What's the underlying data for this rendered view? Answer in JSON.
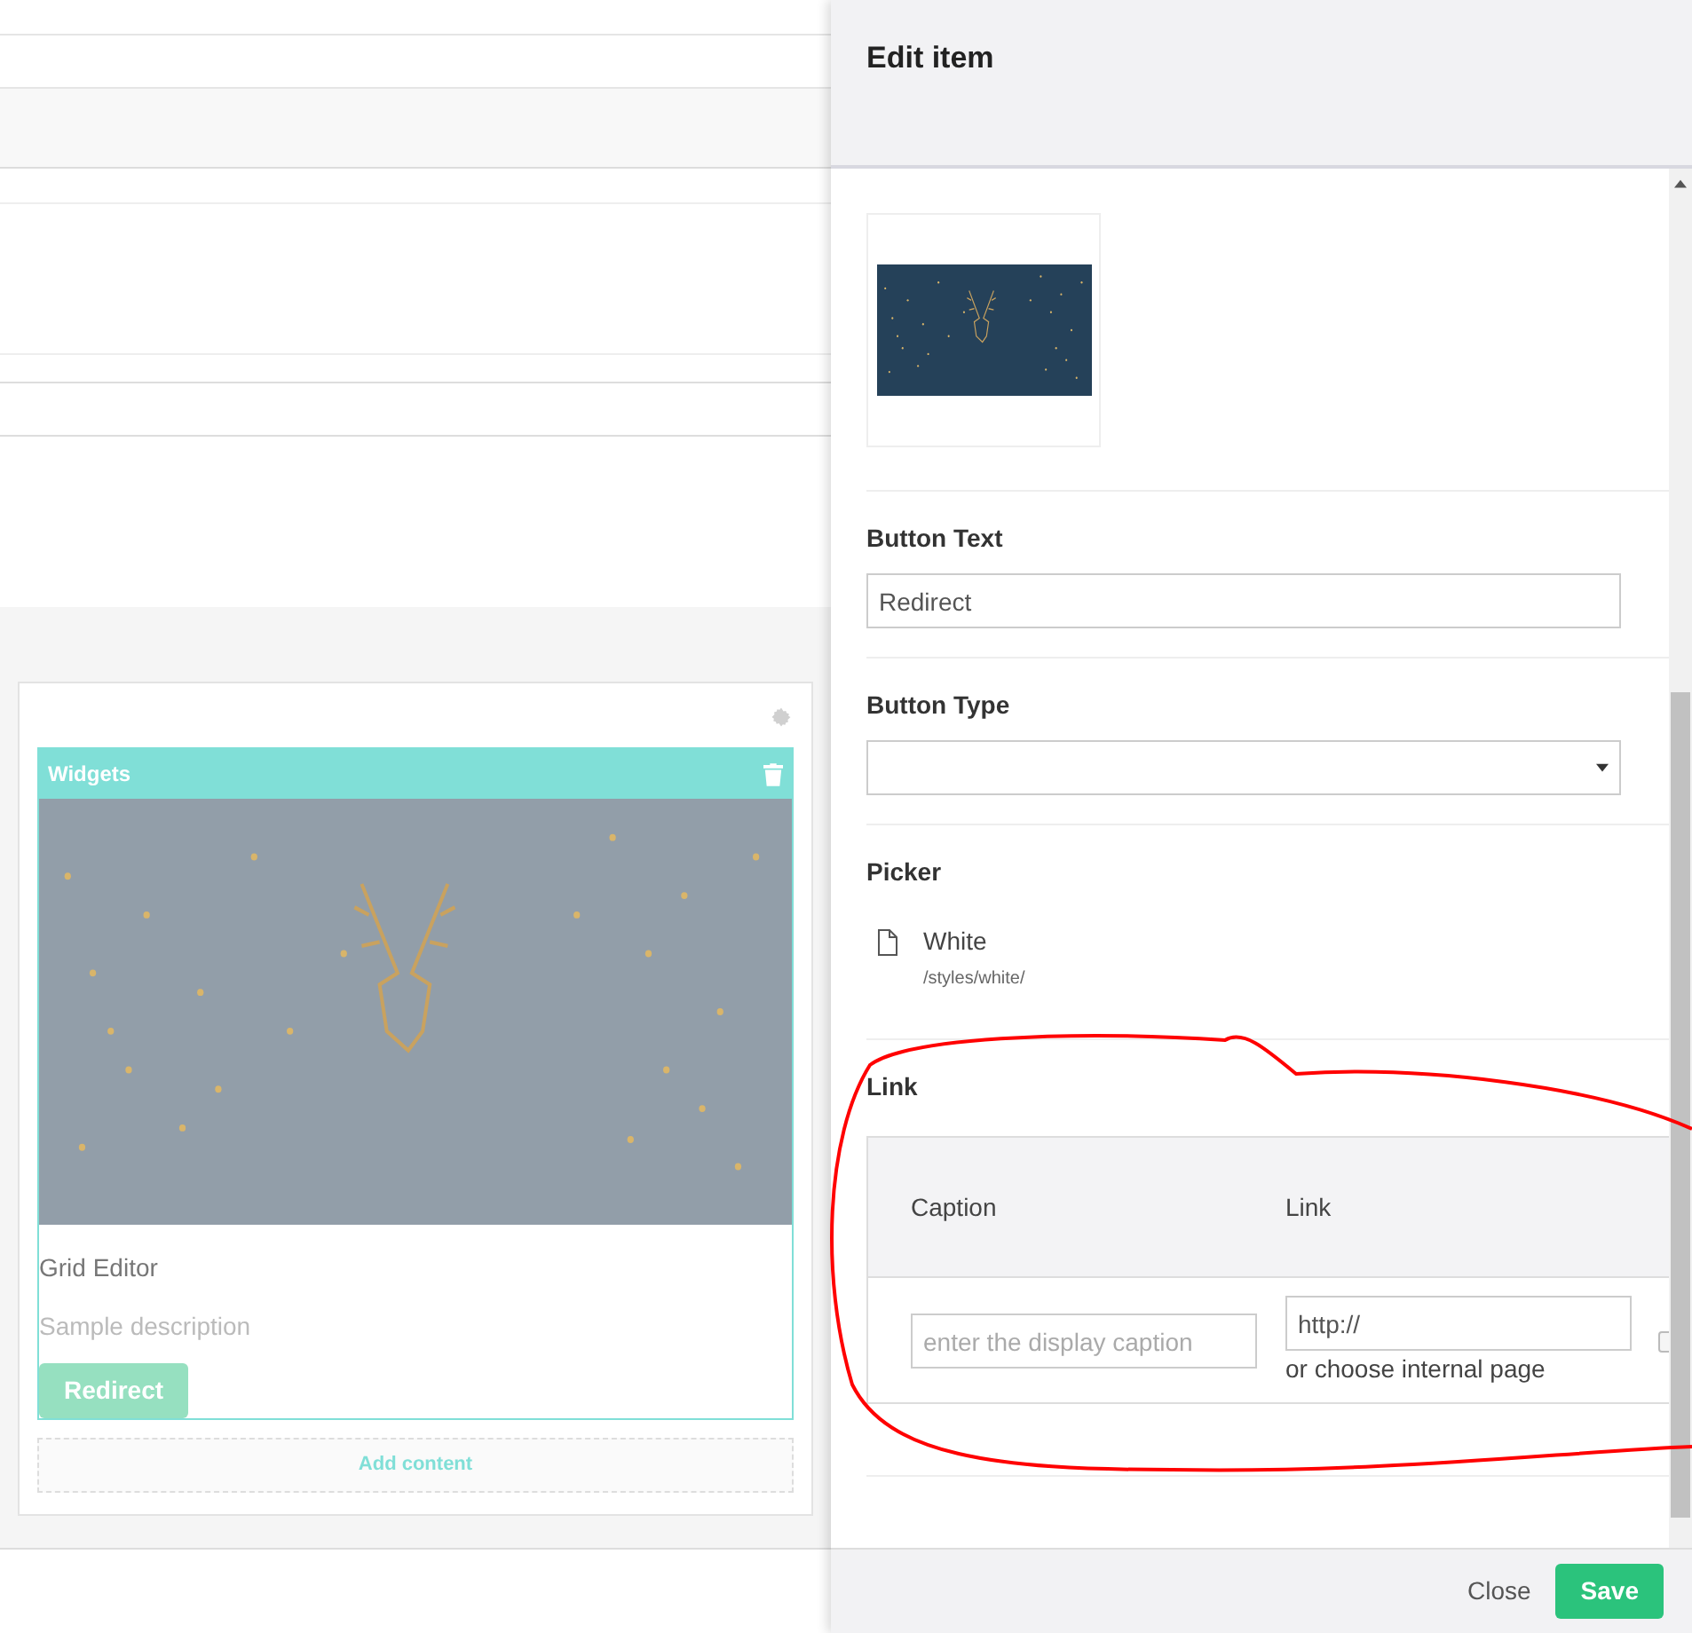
{
  "background": {
    "widget": {
      "title": "Widgets",
      "heading": "Grid Editor",
      "description": "Sample description",
      "button": "Redirect",
      "add_content": "Add content"
    }
  },
  "dialog": {
    "title": "Edit item",
    "button_text": {
      "label": "Button Text",
      "value": "Redirect"
    },
    "button_type": {
      "label": "Button Type"
    },
    "picker": {
      "label": "Picker",
      "name": "White",
      "path": "/styles/white/"
    },
    "link": {
      "label": "Link",
      "columns": [
        "Caption",
        "Link"
      ],
      "caption_placeholder": "enter the display caption",
      "url_value": "http://",
      "internal_page": "or choose internal page",
      "new_window_checked": false
    },
    "footer": {
      "close": "Close",
      "save": "Save"
    }
  }
}
